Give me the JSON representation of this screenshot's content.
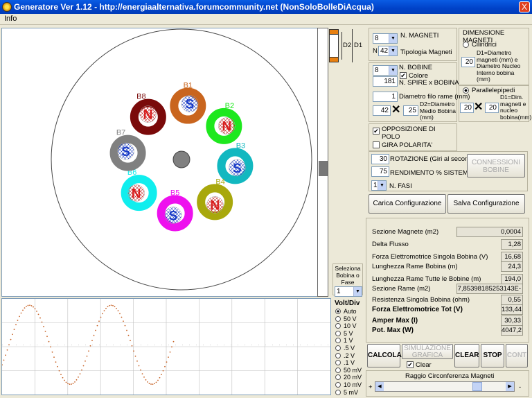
{
  "window": {
    "title": "Generatore Ver 1.12 - http://energiaalternativa.forumcommunity.net (NonSoloBolleDiAcqua)",
    "close": "X"
  },
  "menu": {
    "info": "Info"
  },
  "coils": [
    {
      "name": "B1",
      "color": "#c9651e",
      "letter": "S",
      "letter_color": "#1a3cc8"
    },
    {
      "name": "B2",
      "color": "#1ee81e",
      "letter": "N",
      "letter_color": "#d81e1e"
    },
    {
      "name": "B3",
      "color": "#12b8c0",
      "letter": "S",
      "letter_color": "#1a3cc8"
    },
    {
      "name": "B4",
      "color": "#a8a80c",
      "letter": "N",
      "letter_color": "#d81e1e"
    },
    {
      "name": "B5",
      "color": "#ee10ee",
      "letter": "S",
      "letter_color": "#1a3cc8"
    },
    {
      "name": "B6",
      "color": "#10eeee",
      "letter": "N",
      "letter_color": "#d81e1e"
    },
    {
      "name": "B7",
      "color": "#808080",
      "letter": "S",
      "letter_color": "#1a3cc8"
    },
    {
      "name": "B8",
      "color": "#7a0a0a",
      "letter": "N",
      "letter_color": "#d81e1e"
    }
  ],
  "magnet_side": {
    "d2": "D2",
    "d1": "D1"
  },
  "controls": {
    "n_magneti_value": "8",
    "n_magneti_label": "N. MAGNETI",
    "tipologia_prefix": "N",
    "tipologia_value": "42",
    "tipologia_label": "Tipologia Magneti",
    "n_bobine_value": "8",
    "n_bobine_label": "N. BOBINE",
    "colore_label": "Colore",
    "colore_checked": "✔",
    "spire_value": "181",
    "spire_label": "N. SPIRE x BOBINA",
    "diametro_filo_value": "1",
    "diametro_filo_label": "Diametro filo rame (mm)",
    "d2_a": "42",
    "d2_b": "25",
    "d2_label": "D2=Diametro Medio Bobina (mm)",
    "opposizione_label": "OPPOSIZIONE DI POLO",
    "opposizione_checked": "✔",
    "gira_label": "GIRA POLARITA'",
    "rotazione_value": "30",
    "rotazione_label": "ROTAZIONE (Giri al secondo)",
    "rendimento_value": "75",
    "rendimento_label": "RENDIMENTO % SISTEMA",
    "fasi_value": "1",
    "fasi_label": "N. FASI",
    "connessioni_label": "CONNESSIONI BOBINE",
    "carica_label": "Carica  Configurazione",
    "salva_label": "Salva Configurazione"
  },
  "dimensions": {
    "title": "DIMENSIONE MAGNETI",
    "cilindrici_label": "Cilindrici",
    "cil_value": "20",
    "cil_desc": "D1=Diametro magneti (mm) e Diametro Nucleo Interno bobina (mm)",
    "para_label": "Parallelepipedi",
    "para_a": "20",
    "para_b": "20",
    "para_desc": "D1=Dim. magneti e nucleo bobina(mm)"
  },
  "results": [
    {
      "label": "Sezione Magnete (m2)",
      "value": "0,0004",
      "bold": false
    },
    {
      "label": "Delta Flusso",
      "value": "1,28",
      "bold": false
    },
    {
      "label": "Forza Elettromotrice Singola Bobina (V)",
      "value": "16,68",
      "bold": false
    },
    {
      "label": "Lunghezza Rame Bobina (m)",
      "value": "24,3",
      "bold": false
    },
    {
      "label": "Lunghezza Rame Tutte le Bobine (m)",
      "value": "194,0",
      "bold": false
    },
    {
      "label": "Sezione Rame  (m2)",
      "value": "7,85398185253143E-07",
      "bold": false
    },
    {
      "label": "Resistenza Singola Bobina (ohm)",
      "value": "0,55",
      "bold": false
    },
    {
      "label": "Forza Elettromotrice Tot (V)",
      "value": "133,44",
      "bold": true
    },
    {
      "label": "Amper Max (I)",
      "value": "30,33",
      "bold": true
    },
    {
      "label": "Pot. Max (W)",
      "value": "4047,2",
      "bold": true
    }
  ],
  "actions": {
    "calcola": "CALCOLA",
    "simulazione": "SIMULAZIONE GRAFICA",
    "clear_chk": "Clear",
    "clear": "CLEAR",
    "stop": "STOP",
    "cont": "CONT"
  },
  "raggio": {
    "label": "Raggio Circonferenza Magneti",
    "plus": "+",
    "minus": "-"
  },
  "seleziona": {
    "label": "Seleziona Bobina o Fase",
    "value": "1"
  },
  "voltdiv": {
    "title": "Volt/Div",
    "options": [
      "Auto",
      "50 V",
      "10 V",
      "5 V",
      "1 V",
      ".5 V",
      ".2 V",
      ".1 V",
      "50 mV",
      "20 mV",
      "10 mV",
      "5 mV"
    ],
    "selected": "Auto"
  },
  "colors": {
    "title_bar": "#0a5ce4",
    "waveform": "#c86428",
    "grid": "#c0c0c0"
  }
}
